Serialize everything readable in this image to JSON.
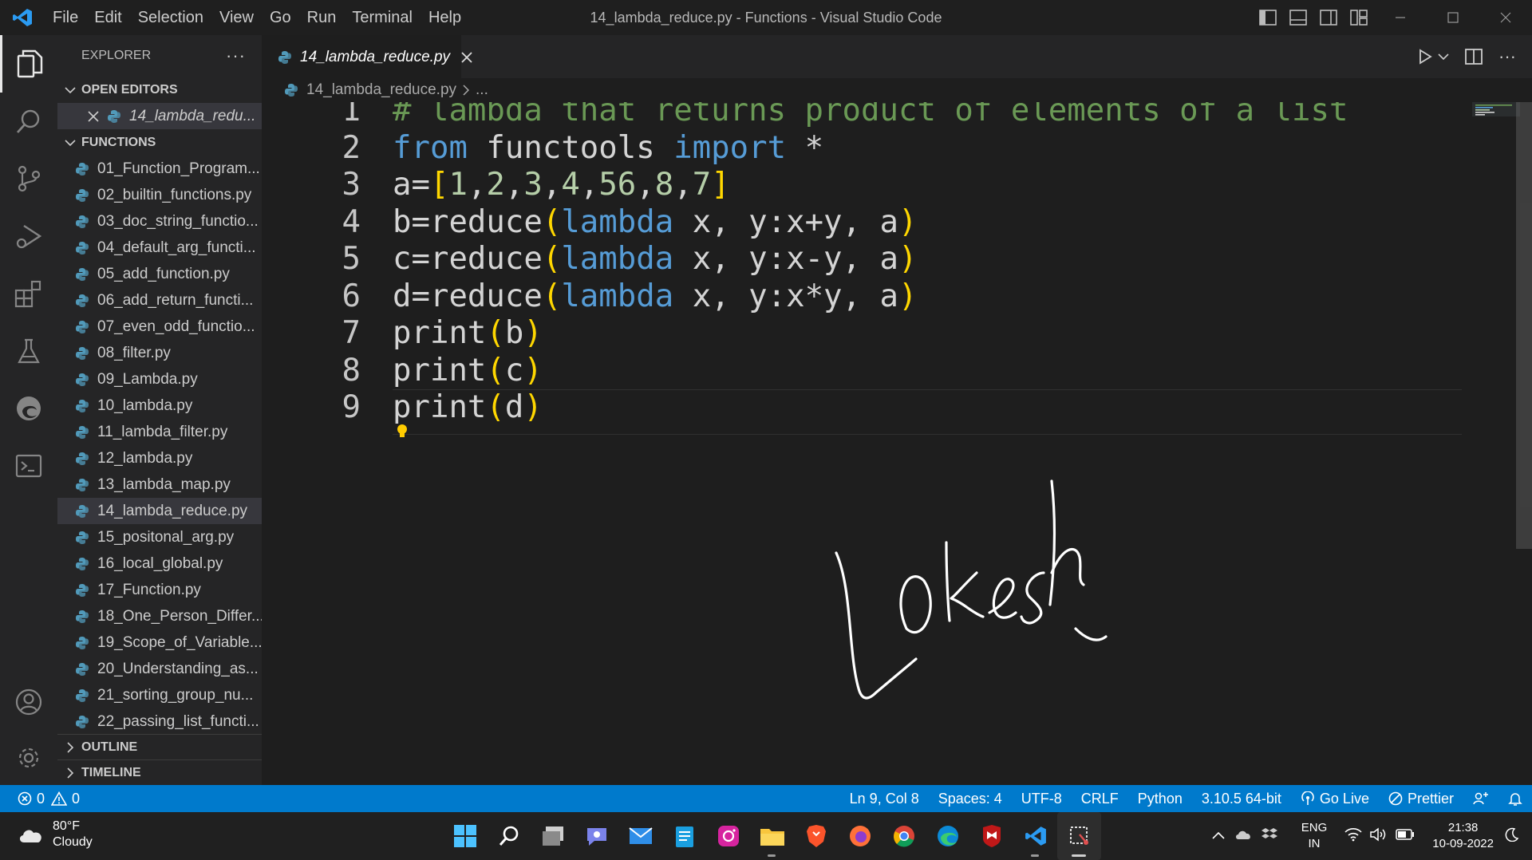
{
  "titlebar": {
    "menu": [
      "File",
      "Edit",
      "Selection",
      "View",
      "Go",
      "Run",
      "Terminal",
      "Help"
    ],
    "window_title": "14_lambda_reduce.py - Functions - Visual Studio Code"
  },
  "activitybar": {
    "icons": [
      "explorer-icon",
      "search-icon",
      "source-control-icon",
      "run-debug-icon",
      "extensions-icon",
      "testing-icon",
      "edge-devtools-icon",
      "terminal-icon",
      "account-icon",
      "settings-gear-icon"
    ]
  },
  "sidebar": {
    "header": "EXPLORER",
    "open_editors_title": "OPEN EDITORS",
    "open_editor_file": "14_lambda_redu...",
    "folder_title": "FUNCTIONS",
    "files": [
      "01_Function_Program...",
      "02_builtin_functions.py",
      "03_doc_string_functio...",
      "04_default_arg_functi...",
      "05_add_function.py",
      "06_add_return_functi...",
      "07_even_odd_functio...",
      "08_filter.py",
      "09_Lambda.py",
      "10_lambda.py",
      "11_lambda_filter.py",
      "12_lambda.py",
      "13_lambda_map.py",
      "14_lambda_reduce.py",
      "15_positonal_arg.py",
      "16_local_global.py",
      "17_Function.py",
      "18_One_Person_Differ...",
      "19_Scope_of_Variable...",
      "20_Understanding_as...",
      "21_sorting_group_nu...",
      "22_passing_list_functi..."
    ],
    "selected_index": 13,
    "outline_title": "OUTLINE",
    "timeline_title": "TIMELINE"
  },
  "editor": {
    "tab_label": "14_lambda_reduce.py",
    "breadcrumb_file": "14_lambda_reduce.py",
    "breadcrumb_rest": "...",
    "current_line": 9,
    "lines": [
      {
        "num": "1",
        "tokens": [
          {
            "t": "# lambda that returns product of elements of a list",
            "c": "comment"
          }
        ]
      },
      {
        "num": "2",
        "tokens": [
          {
            "t": "from",
            "c": "kw"
          },
          {
            "t": " functools ",
            "c": "plain"
          },
          {
            "t": "import",
            "c": "kw"
          },
          {
            "t": " *",
            "c": "plain"
          }
        ]
      },
      {
        "num": "3",
        "tokens": [
          {
            "t": "a=",
            "c": "plain"
          },
          {
            "t": "[",
            "c": "bracket"
          },
          {
            "t": "1",
            "c": "num"
          },
          {
            "t": ",",
            "c": "plain"
          },
          {
            "t": "2",
            "c": "num"
          },
          {
            "t": ",",
            "c": "plain"
          },
          {
            "t": "3",
            "c": "num"
          },
          {
            "t": ",",
            "c": "plain"
          },
          {
            "t": "4",
            "c": "num"
          },
          {
            "t": ",",
            "c": "plain"
          },
          {
            "t": "56",
            "c": "num"
          },
          {
            "t": ",",
            "c": "plain"
          },
          {
            "t": "8",
            "c": "num"
          },
          {
            "t": ",",
            "c": "plain"
          },
          {
            "t": "7",
            "c": "num"
          },
          {
            "t": "]",
            "c": "bracket"
          }
        ]
      },
      {
        "num": "4",
        "tokens": [
          {
            "t": "b=reduce",
            "c": "plain"
          },
          {
            "t": "(",
            "c": "bracket"
          },
          {
            "t": "lambda",
            "c": "kw"
          },
          {
            "t": " x, y:x+y, a",
            "c": "plain"
          },
          {
            "t": ")",
            "c": "bracket"
          }
        ]
      },
      {
        "num": "5",
        "tokens": [
          {
            "t": "c=reduce",
            "c": "plain"
          },
          {
            "t": "(",
            "c": "bracket"
          },
          {
            "t": "lambda",
            "c": "kw"
          },
          {
            "t": " x, y:x-y, a",
            "c": "plain"
          },
          {
            "t": ")",
            "c": "bracket"
          }
        ]
      },
      {
        "num": "6",
        "tokens": [
          {
            "t": "d=reduce",
            "c": "plain"
          },
          {
            "t": "(",
            "c": "bracket"
          },
          {
            "t": "lambda",
            "c": "kw"
          },
          {
            "t": " x, y:x*y, a",
            "c": "plain"
          },
          {
            "t": ")",
            "c": "bracket"
          }
        ]
      },
      {
        "num": "7",
        "tokens": [
          {
            "t": "print",
            "c": "plain"
          },
          {
            "t": "(",
            "c": "bracket"
          },
          {
            "t": "b",
            "c": "plain"
          },
          {
            "t": ")",
            "c": "bracket"
          }
        ]
      },
      {
        "num": "8",
        "tokens": [
          {
            "t": "print",
            "c": "plain"
          },
          {
            "t": "(",
            "c": "bracket"
          },
          {
            "t": "c",
            "c": "plain"
          },
          {
            "t": ")",
            "c": "bracket"
          }
        ]
      },
      {
        "num": "9",
        "tokens": [
          {
            "t": "print",
            "c": "plain"
          },
          {
            "t": "(",
            "c": "bracket"
          },
          {
            "t": "d",
            "c": "plain"
          },
          {
            "t": ")",
            "c": "bracket"
          }
        ]
      }
    ],
    "handwriting": "Lokesh"
  },
  "statusbar": {
    "errors": "0",
    "warnings": "0",
    "position": "Ln 9, Col 8",
    "spaces": "Spaces: 4",
    "encoding": "UTF-8",
    "eol": "CRLF",
    "language": "Python",
    "interpreter": "3.10.5 64-bit",
    "golive": "Go Live",
    "prettier": "Prettier"
  },
  "taskbar": {
    "temperature": "80°F",
    "weather": "Cloudy",
    "lang_top": "ENG",
    "lang_bottom": "IN",
    "time": "21:38",
    "date": "10-09-2022",
    "apps": [
      "windows-start-icon",
      "search-icon",
      "task-view-icon",
      "teams-chat-icon",
      "mail-icon",
      "notepad-icon",
      "instagram-icon",
      "file-explorer-icon",
      "brave-icon",
      "firefox-icon",
      "chrome-icon",
      "edge-icon",
      "mcafee-icon",
      "vscode-icon",
      "snipping-tool-icon"
    ]
  },
  "colors": {
    "accent": "#007acc",
    "comment": "#6a9955",
    "keyword": "#569cd6",
    "number": "#b5cea8",
    "bracket": "#ffd700"
  }
}
